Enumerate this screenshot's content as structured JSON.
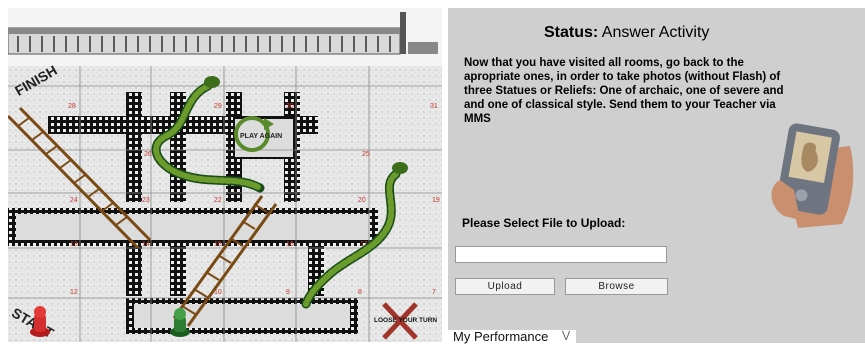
{
  "board": {
    "finish_label": "FINISH",
    "start_label": "START",
    "play_again_label": "PLAY AGAIN",
    "lose_turn_label": "LOOSE YOUR TURN",
    "cells": [
      "28",
      "29",
      "30",
      "31",
      "26",
      "25",
      "24",
      "23",
      "22",
      "20",
      "19",
      "13",
      "14",
      "15",
      "16",
      "17",
      "12",
      "10",
      "9",
      "8",
      "7"
    ]
  },
  "status": {
    "prefix": "Status:",
    "value": "Answer Activity"
  },
  "instructions": "Now that you have visited all rooms, go back to the apropriate ones, in order  to take photos (without Flash) of three Statues or Reliefs: One of archaic, one of severe and and one of classical style. Send them to your Teacher via MMS",
  "upload": {
    "label": "Please Select File to Upload:",
    "file_value": "",
    "upload_button": "Upload",
    "browse_button": "Browse"
  },
  "performance_select": {
    "selected": "My Performance"
  },
  "icons": {
    "phone": "phone-with-statue-icon",
    "chevron": "chevron-down-icon"
  }
}
